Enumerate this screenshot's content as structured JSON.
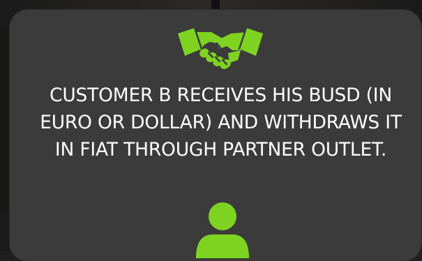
{
  "card": {
    "message": "CUSTOMER B RECEIVES HIS BUSD (IN EURO OR DOLLAR) AND WITHDRAWS IT IN FIAT THROUGH PARTNER OUTLET."
  },
  "icons": {
    "top": "handshake-icon",
    "bottom": "user-icon"
  },
  "colors": {
    "accent": "#7ED321",
    "card": "#3B3B3B",
    "text": "#FFFFFF"
  }
}
